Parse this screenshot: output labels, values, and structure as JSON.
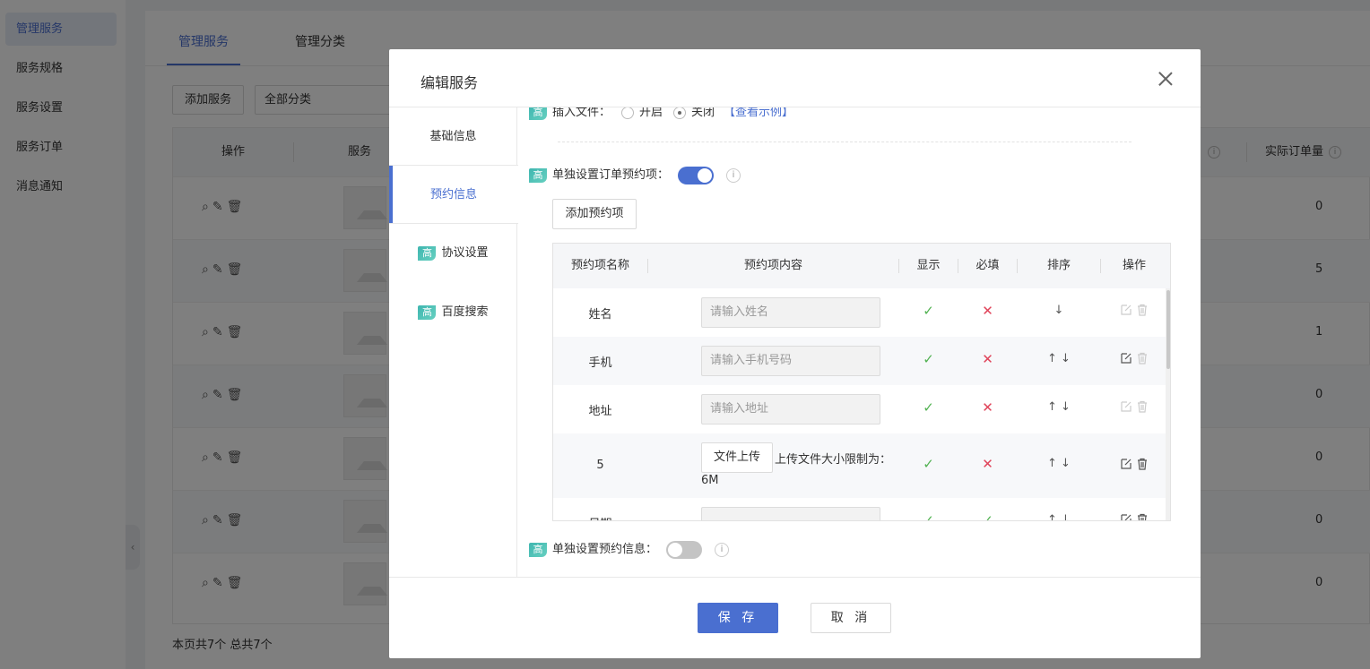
{
  "sidebar": {
    "items": [
      {
        "label": "管理服务",
        "active": true
      },
      {
        "label": "服务规格"
      },
      {
        "label": "服务设置"
      },
      {
        "label": "服务订单"
      },
      {
        "label": "消息通知"
      }
    ],
    "collapse_glyph": "‹"
  },
  "main": {
    "tabs": [
      {
        "label": "管理服务"
      },
      {
        "label": "管理分类"
      }
    ],
    "add_button": "添加服务",
    "category_select": "全部分类",
    "table_headers": {
      "ops": "操作",
      "service": "服务",
      "actual_orders": "实际订单量",
      "info": "i"
    },
    "rows": [
      {
        "actual_orders": "0"
      },
      {
        "actual_orders": "5"
      },
      {
        "actual_orders": "1"
      },
      {
        "actual_orders": "0"
      },
      {
        "actual_orders": "0"
      },
      {
        "actual_orders": "0"
      },
      {
        "actual_orders": "0"
      }
    ],
    "footer": "本页共7个   总共7个"
  },
  "modal": {
    "title": "编辑服务",
    "tabs": [
      {
        "label": "基础信息"
      },
      {
        "label": "预约信息",
        "active": true
      },
      {
        "label": "协议设置",
        "badge": "高"
      },
      {
        "label": "百度搜索",
        "badge": "高"
      }
    ],
    "badge": "高",
    "insert_file": {
      "label": "插入文件：",
      "option_on": "开启",
      "option_off": "关闭",
      "selected": "关闭",
      "example_link": "【查看示例】"
    },
    "order_items": {
      "label": "单独设置订单预约项：",
      "enabled": true
    },
    "info_glyph": "i",
    "add_item_button": "添加预约项",
    "items_table": {
      "headers": {
        "name": "预约项名称",
        "content": "预约项内容",
        "show": "显示",
        "required": "必填",
        "sort": "排序",
        "ops": "操作"
      },
      "rows": [
        {
          "name": "姓名",
          "placeholder": "请输入姓名",
          "show": true,
          "required": false,
          "sort": "↓"
        },
        {
          "name": "手机",
          "placeholder": "请输入手机号码",
          "show": true,
          "required": false,
          "sort": "↑ ↓"
        },
        {
          "name": "地址",
          "placeholder": "请输入地址",
          "show": true,
          "required": false,
          "sort": "↑ ↓"
        },
        {
          "name": "5",
          "upload_label": "文件上传",
          "upload_note": "上传文件大小限制为：",
          "upload_size": "6M",
          "show": true,
          "required": false,
          "sort": "↑ ↓"
        },
        {
          "name": "日期",
          "placeholder": "",
          "show": true,
          "required": true,
          "sort": "↑ ↓"
        }
      ]
    },
    "booking_info": {
      "label": "单独设置预约信息：",
      "enabled": false
    },
    "save_button": "保 存",
    "cancel_button": "取 消"
  },
  "glyphs": {
    "check": "✓",
    "cross": "✕",
    "search": "⌕",
    "edit": "✎",
    "trash": "🗑"
  },
  "colors": {
    "accent": "#4a6fd0",
    "check": "#52b252",
    "cross": "#e0445a",
    "badge": "#3fb6b0"
  }
}
